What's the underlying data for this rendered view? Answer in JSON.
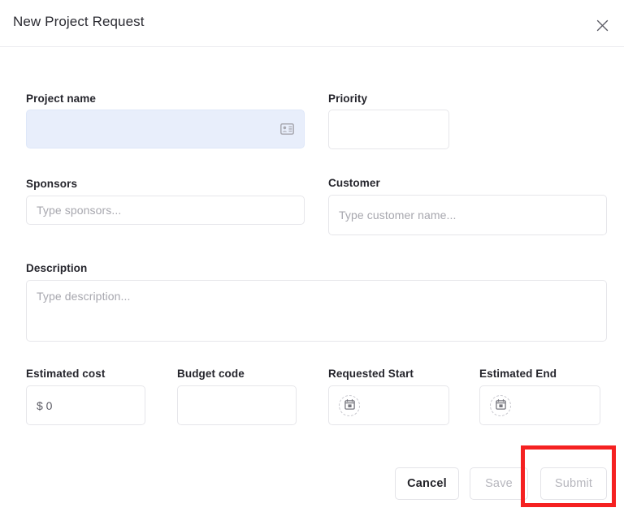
{
  "dialog": {
    "title": "New Project Request",
    "close_icon": "close-icon"
  },
  "fields": {
    "project_name": {
      "label": "Project name",
      "value": "",
      "placeholder": "",
      "icon": "contact-card-icon",
      "state": "highlighted"
    },
    "priority": {
      "label": "Priority",
      "value": "",
      "placeholder": ""
    },
    "sponsors": {
      "label": "Sponsors",
      "value": "",
      "placeholder": "Type sponsors..."
    },
    "customer": {
      "label": "Customer",
      "value": "",
      "placeholder": "Type customer name..."
    },
    "description": {
      "label": "Description",
      "value": "",
      "placeholder": "Type description..."
    },
    "estimated_cost": {
      "label": "Estimated cost",
      "value": "$ 0",
      "placeholder": ""
    },
    "budget_code": {
      "label": "Budget code",
      "value": "",
      "placeholder": ""
    },
    "requested_start": {
      "label": "Requested Start",
      "value": "",
      "icon": "calendar-icon"
    },
    "estimated_end": {
      "label": "Estimated End",
      "value": "",
      "icon": "calendar-icon"
    }
  },
  "footer": {
    "cancel_label": "Cancel",
    "save_label": "Save",
    "submit_label": "Submit",
    "save_enabled": false,
    "submit_enabled": false
  },
  "annotation": {
    "color": "#f52121",
    "target": "submit-button"
  }
}
